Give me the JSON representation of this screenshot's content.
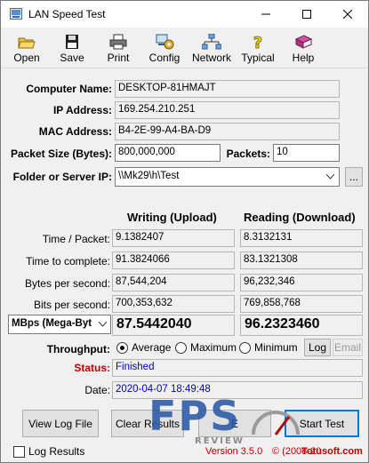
{
  "window": {
    "title": "LAN Speed Test"
  },
  "toolbar": {
    "items": [
      {
        "label": "Open",
        "icon": "folder-open-icon"
      },
      {
        "label": "Save",
        "icon": "floppy-disk-icon"
      },
      {
        "label": "Print",
        "icon": "printer-icon"
      },
      {
        "label": "Config",
        "icon": "config-icon"
      },
      {
        "label": "Network",
        "icon": "network-icon"
      },
      {
        "label": "Typical",
        "icon": "help-question-icon"
      },
      {
        "label": "Help",
        "icon": "help-book-icon"
      }
    ]
  },
  "info": {
    "computer_name_label": "Computer Name:",
    "computer_name": "DESKTOP-81HMAJT",
    "ip_label": "IP Address:",
    "ip": "169.254.210.251",
    "mac_label": "MAC Address:",
    "mac": "B4-2E-99-A4-BA-D9",
    "packet_size_label": "Packet Size (Bytes):",
    "packet_size": "800,000,000",
    "packets_label": "Packets:",
    "packets": "10",
    "folder_label": "Folder or Server IP:",
    "folder": "\\\\Mk29\\h\\Test",
    "browse_label": "..."
  },
  "results": {
    "writing_header": "Writing (Upload)",
    "reading_header": "Reading (Download)",
    "rows": [
      {
        "label": "Time / Packet:",
        "write": "9.1382407",
        "read": "8.3132131"
      },
      {
        "label": "Time to complete:",
        "write": "91.3824066",
        "read": "83.1321308"
      },
      {
        "label": "Bytes per second:",
        "write": "87,544,204",
        "read": "96,232,346"
      },
      {
        "label": "Bits per second:",
        "write": "700,353,632",
        "read": "769,858,768"
      }
    ],
    "unit_selected": "MBps (Mega-Byt",
    "write_big": "87.5442040",
    "read_big": "96.2323460"
  },
  "throughput": {
    "label": "Throughput:",
    "options": [
      "Average",
      "Maximum",
      "Minimum"
    ],
    "selected": "Average",
    "log_label": "Log",
    "email_label": "Email"
  },
  "status": {
    "status_label": "Status:",
    "status_value": "Finished",
    "date_label": "Date:",
    "date_value": "2020-04-07 18:49:48",
    "status_color": "#c00000",
    "value_color": "#0000cc"
  },
  "buttons": {
    "view_log": "View Log File",
    "clear_results": "Clear Results",
    "middle": "E",
    "start_test": "Start Test"
  },
  "footer": {
    "log_results_label": "Log Results",
    "version_text": "Version 3.5.0",
    "copyright_text": "© (2008-20",
    "site_text": "Totusoft.com"
  },
  "watermark": {
    "text": "FPS",
    "subtext": "REVIEW"
  }
}
